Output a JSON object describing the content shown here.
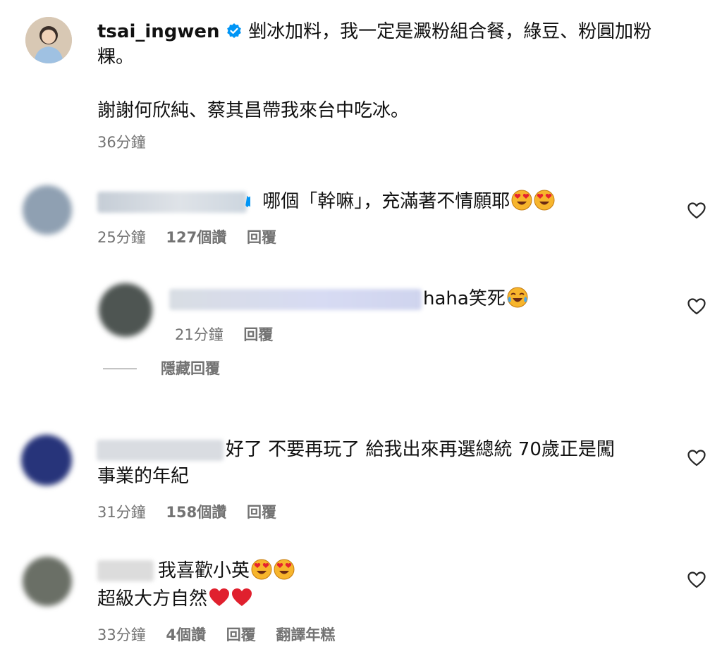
{
  "post": {
    "username": "tsai_ingwen",
    "caption_line1": "剉冰加料，我一定是澱粉組合餐，綠豆、粉圓加粉",
    "caption_line2": "粿。",
    "caption_line3": "謝謝何欣純、蔡其昌帶我來台中吃冰。",
    "time": "36分鐘"
  },
  "comments": [
    {
      "text": "哪個「幹嘛」，充滿著不情願耶",
      "time": "25分鐘",
      "likes": "127個讚",
      "reply": "回覆"
    },
    {
      "text": "haha笑死",
      "time": "21分鐘",
      "reply": "回覆",
      "hide_replies": "隱藏回覆"
    },
    {
      "text_line1": "好了 不要再玩了 給我出來再選總統 70歲正是闖",
      "text_line2": "事業的年紀",
      "time": "31分鐘",
      "likes": "158個讚",
      "reply": "回覆"
    },
    {
      "text_line1": "我喜歡小英",
      "text_line2": "超級大方自然",
      "time": "33分鐘",
      "likes": "4個讚",
      "reply": "回覆",
      "translate": "翻譯年糕"
    }
  ],
  "icons": {
    "heart": "heart-outline-icon",
    "verified": "verified-badge-icon"
  },
  "colors": {
    "verified": "#0095f6",
    "meta": "#737373",
    "text": "#111111"
  }
}
